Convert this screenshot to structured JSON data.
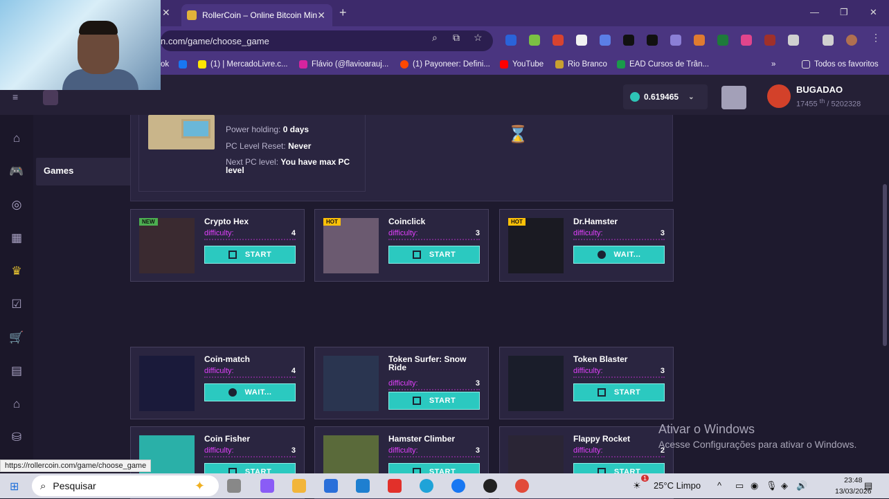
{
  "browser": {
    "active_tab_title": "RollerCoin – Online Bitcoin Min",
    "address": "n.com/game/choose_game",
    "bookmarks": [
      "ok",
      "(1) | MercadoLivre.c...",
      "Flávio (@flavioarauj...",
      "(1) Payoneer: Defini...",
      "YouTube",
      "Rio Branco",
      "EAD Cursos de Trân...",
      "Todos os favoritos"
    ],
    "status_url": "https://rollercoin.com/game/choose_game"
  },
  "header": {
    "balance": "0.619465",
    "username": "BUGADAO",
    "rank": "17455",
    "rank_suffix": "th",
    "rank_total": "/ 5202328"
  },
  "sidebar": {
    "tooltip": "Games"
  },
  "pc_info": {
    "power_holding_label": "Power holding:",
    "power_holding_value": "0 days",
    "reset_label": "PC Level Reset:",
    "reset_value": "Never",
    "next_label": "Next PC level:",
    "next_value": "You have max PC",
    "next_value2": "level"
  },
  "games": [
    {
      "title": "Crypto Hex",
      "tag": "NEW",
      "difficulty": "4",
      "button": "START",
      "waiting": false,
      "tag_color": "#4caf50"
    },
    {
      "title": "Coinclick",
      "tag": "HOT",
      "difficulty": "3",
      "button": "START",
      "waiting": false,
      "tag_color": "#ffc107"
    },
    {
      "title": "Dr.Hamster",
      "tag": "HOT",
      "difficulty": "3",
      "button": "WAIT...",
      "waiting": true,
      "tag_color": "#ffc107"
    },
    {
      "title": "Coin-match",
      "tag": "",
      "difficulty": "4",
      "button": "WAIT...",
      "waiting": true
    },
    {
      "title": "Token Surfer: Snow Ride",
      "tag": "",
      "difficulty": "3",
      "button": "START",
      "waiting": false
    },
    {
      "title": "Token Blaster",
      "tag": "",
      "difficulty": "3",
      "button": "START",
      "waiting": false
    },
    {
      "title": "Coin Fisher",
      "tag": "",
      "difficulty": "3",
      "button": "START",
      "waiting": false
    },
    {
      "title": "Hamster Climber",
      "tag": "",
      "difficulty": "3",
      "button": "START",
      "waiting": false
    },
    {
      "title": "Flappy Rocket",
      "tag": "",
      "difficulty": "2",
      "button": "START",
      "waiting": false
    }
  ],
  "difficulty_label": "difficulty:",
  "watermark": {
    "title": "Ativar o Windows",
    "subtitle": "Acesse Configurações para ativar o Windows."
  },
  "taskbar": {
    "search_placeholder": "Pesquisar",
    "weather": "25°C  Limpo",
    "time": "23:48",
    "date": "13/03/2026",
    "notification_count": "1"
  }
}
